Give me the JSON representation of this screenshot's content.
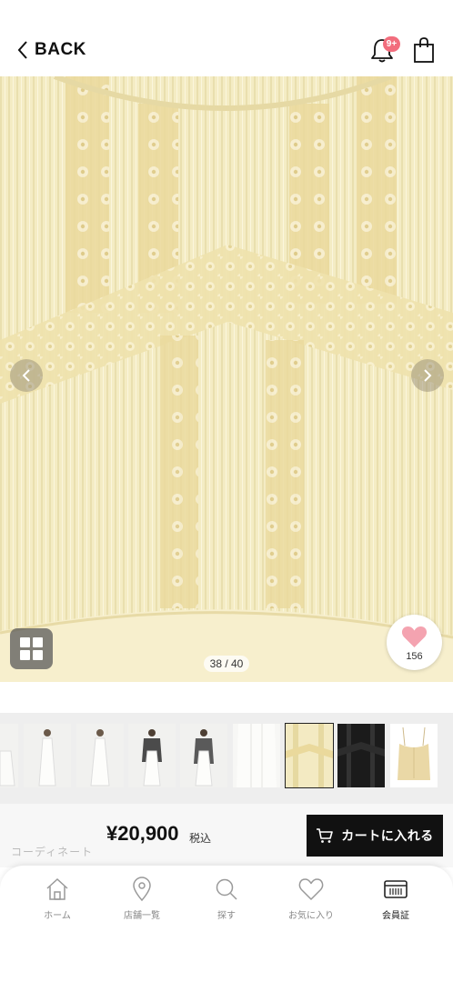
{
  "header": {
    "back_label": "BACK",
    "notification_badge": "9+"
  },
  "gallery": {
    "counter": "38 / 40",
    "favorite_count": "156",
    "thumbnails": [
      "look-1",
      "look-2",
      "look-3",
      "look-4",
      "look-5",
      "detail-white",
      "detail-cream",
      "detail-black",
      "camisole"
    ],
    "selected_thumbnail_index": 6
  },
  "purchase": {
    "coordinate_label": "コーディネート",
    "price": "¥20,900",
    "tax_label": "税込",
    "cart_button_label": "カートに入れる"
  },
  "bottom_nav": {
    "items": [
      {
        "label": "ホーム",
        "icon": "home-icon"
      },
      {
        "label": "店舗一覧",
        "icon": "map-pin-icon"
      },
      {
        "label": "探す",
        "icon": "search-icon"
      },
      {
        "label": "お気に入り",
        "icon": "heart-icon"
      },
      {
        "label": "会員証",
        "icon": "member-card-icon"
      }
    ],
    "active_index": 4
  },
  "colors": {
    "accent_pink": "#f26d7d",
    "fabric_cream": "#f4ecc6",
    "button_black": "#111111"
  }
}
